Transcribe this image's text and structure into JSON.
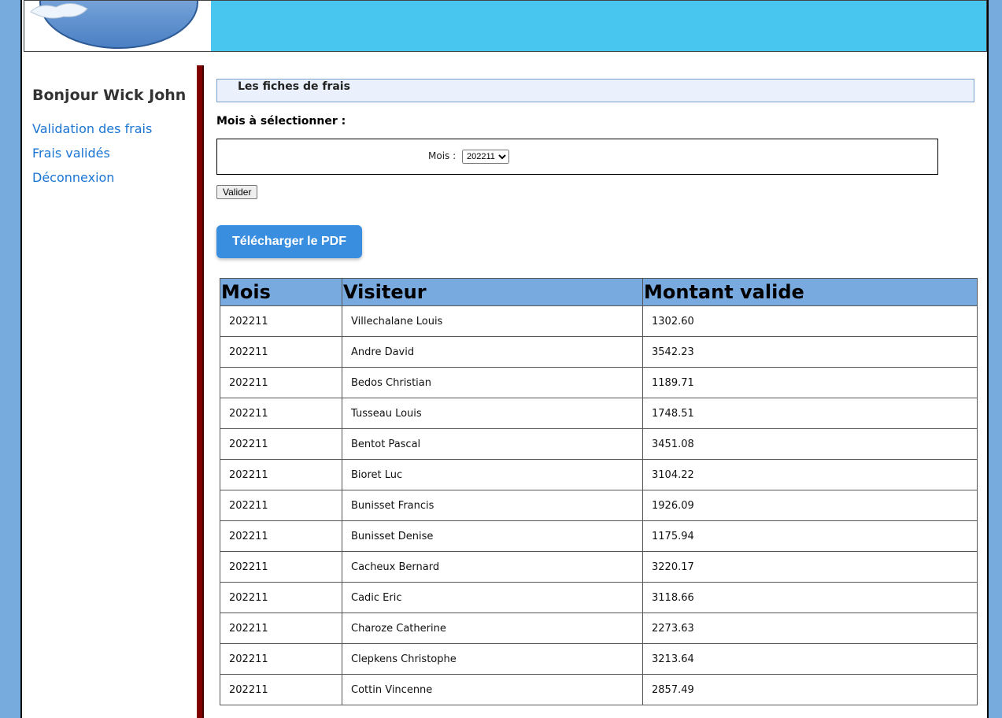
{
  "sidebar": {
    "greeting": "Bonjour Wick John",
    "links": [
      "Validation des frais",
      "Frais validés",
      "Déconnexion"
    ]
  },
  "content": {
    "section_title": "Les fiches de frais",
    "month_label": "Mois à sélectionner :",
    "month_field_label": "Mois :",
    "month_selected": "202211",
    "valider_label": "Valider",
    "pdf_label": "Télécharger le PDF"
  },
  "table": {
    "headers": [
      "Mois",
      "Visiteur",
      "Montant valide"
    ],
    "rows": [
      [
        "202211",
        "Villechalane Louis",
        "1302.60"
      ],
      [
        "202211",
        "Andre David",
        "3542.23"
      ],
      [
        "202211",
        "Bedos Christian",
        "1189.71"
      ],
      [
        "202211",
        "Tusseau Louis",
        "1748.51"
      ],
      [
        "202211",
        "Bentot Pascal",
        "3451.08"
      ],
      [
        "202211",
        "Bioret Luc",
        "3104.22"
      ],
      [
        "202211",
        "Bunisset Francis",
        "1926.09"
      ],
      [
        "202211",
        "Bunisset Denise",
        "1175.94"
      ],
      [
        "202211",
        "Cacheux Bernard",
        "3220.17"
      ],
      [
        "202211",
        "Cadic Eric",
        "3118.66"
      ],
      [
        "202211",
        "Charoze Catherine",
        "2273.63"
      ],
      [
        "202211",
        "Clepkens Christophe",
        "3213.64"
      ],
      [
        "202211",
        "Cottin Vincenne",
        "2857.49"
      ]
    ]
  },
  "colors": {
    "banner": "#48c6f0",
    "background": "#77aadd",
    "link": "#1a75d2",
    "divider": "#800000",
    "table_header": "#79aadf",
    "pdf_button": "#3a8ee0"
  }
}
